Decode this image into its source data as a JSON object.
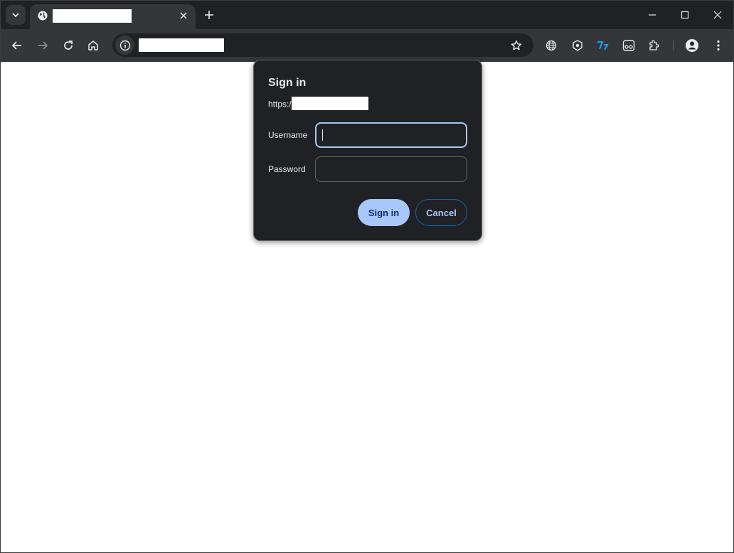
{
  "browser": {
    "tab": {
      "title": ""
    },
    "address_bar": {
      "url": ""
    }
  },
  "dialog": {
    "title": "Sign in",
    "origin_prefix": "https:/",
    "username_label": "Username",
    "username_value": "",
    "password_label": "Password",
    "password_value": "",
    "sign_in_button": "Sign in",
    "cancel_button": "Cancel"
  },
  "colors": {
    "tabstrip": "#202124",
    "toolbar": "#35363a",
    "dialog_bg": "#202124",
    "accent": "#a8c7fa",
    "focus_border": "#a8c7fa",
    "cancel_border": "#0b6aa7"
  },
  "icons": {
    "tab_search": "chevron-down-icon",
    "tab_favicon": "globe-icon",
    "tab_close": "close-icon",
    "new_tab": "plus-icon",
    "minimize": "minimize-icon",
    "maximize": "maximize-icon",
    "close_window": "close-icon",
    "back": "arrow-left-icon",
    "forward": "arrow-right-icon",
    "reload": "reload-icon",
    "home": "home-icon",
    "site_info": "info-icon",
    "bookmark": "star-icon",
    "extensions": [
      "globe-icon",
      "shield-icon",
      "translate-icon",
      "glasses-icon",
      "puzzle-icon"
    ],
    "profile": "profile-icon",
    "menu": "kebab-menu-icon"
  }
}
